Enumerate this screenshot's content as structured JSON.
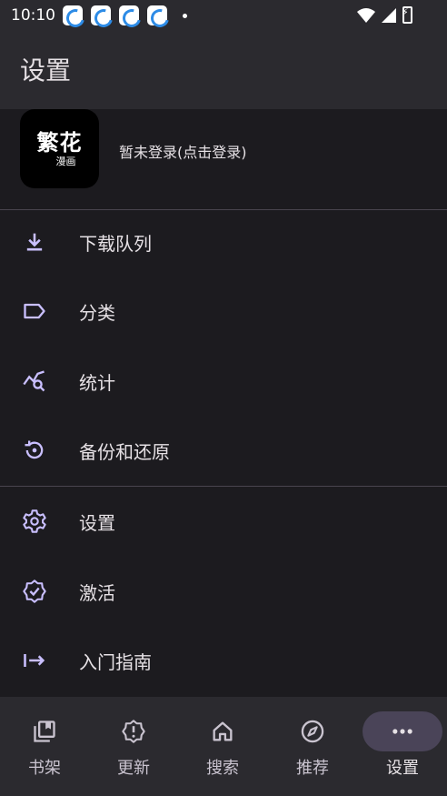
{
  "status_bar": {
    "time": "10:10",
    "notification_icons": [
      "app-notification-icon",
      "app-notification-icon",
      "app-notification-icon",
      "app-notification-icon"
    ],
    "right_icons": [
      "wifi-icon",
      "signal-icon",
      "battery-charging-icon"
    ]
  },
  "header": {
    "title": "设置"
  },
  "account": {
    "logo_text_main": "繁花",
    "logo_text_sub": "漫画",
    "login_prompt": "暂未登录(点击登录)"
  },
  "menu": {
    "items": [
      {
        "label": "下载队列",
        "icon": "download-icon"
      },
      {
        "label": "分类",
        "icon": "label-icon"
      },
      {
        "label": "统计",
        "icon": "query-stats-icon"
      },
      {
        "label": "备份和还原",
        "icon": "backup-restore-icon"
      },
      {
        "label": "设置",
        "icon": "gear-icon"
      },
      {
        "label": "激活",
        "icon": "verified-badge-icon"
      },
      {
        "label": "入门指南",
        "icon": "arrow-right-to-line-icon"
      }
    ]
  },
  "bottom_nav": {
    "items": [
      {
        "label": "书架",
        "icon": "bookshelf-icon",
        "active": false
      },
      {
        "label": "更新",
        "icon": "new-releases-icon",
        "active": false
      },
      {
        "label": "搜索",
        "icon": "home-icon",
        "active": false
      },
      {
        "label": "推荐",
        "icon": "compass-icon",
        "active": false
      },
      {
        "label": "设置",
        "icon": "more-horizontal-icon",
        "active": true
      }
    ]
  },
  "colors": {
    "background": "#1c1b1f",
    "surface": "#2b2a2f",
    "accent_icon": "#c9bfff",
    "active_pill": "#4a4458",
    "divider": "#49454f"
  }
}
